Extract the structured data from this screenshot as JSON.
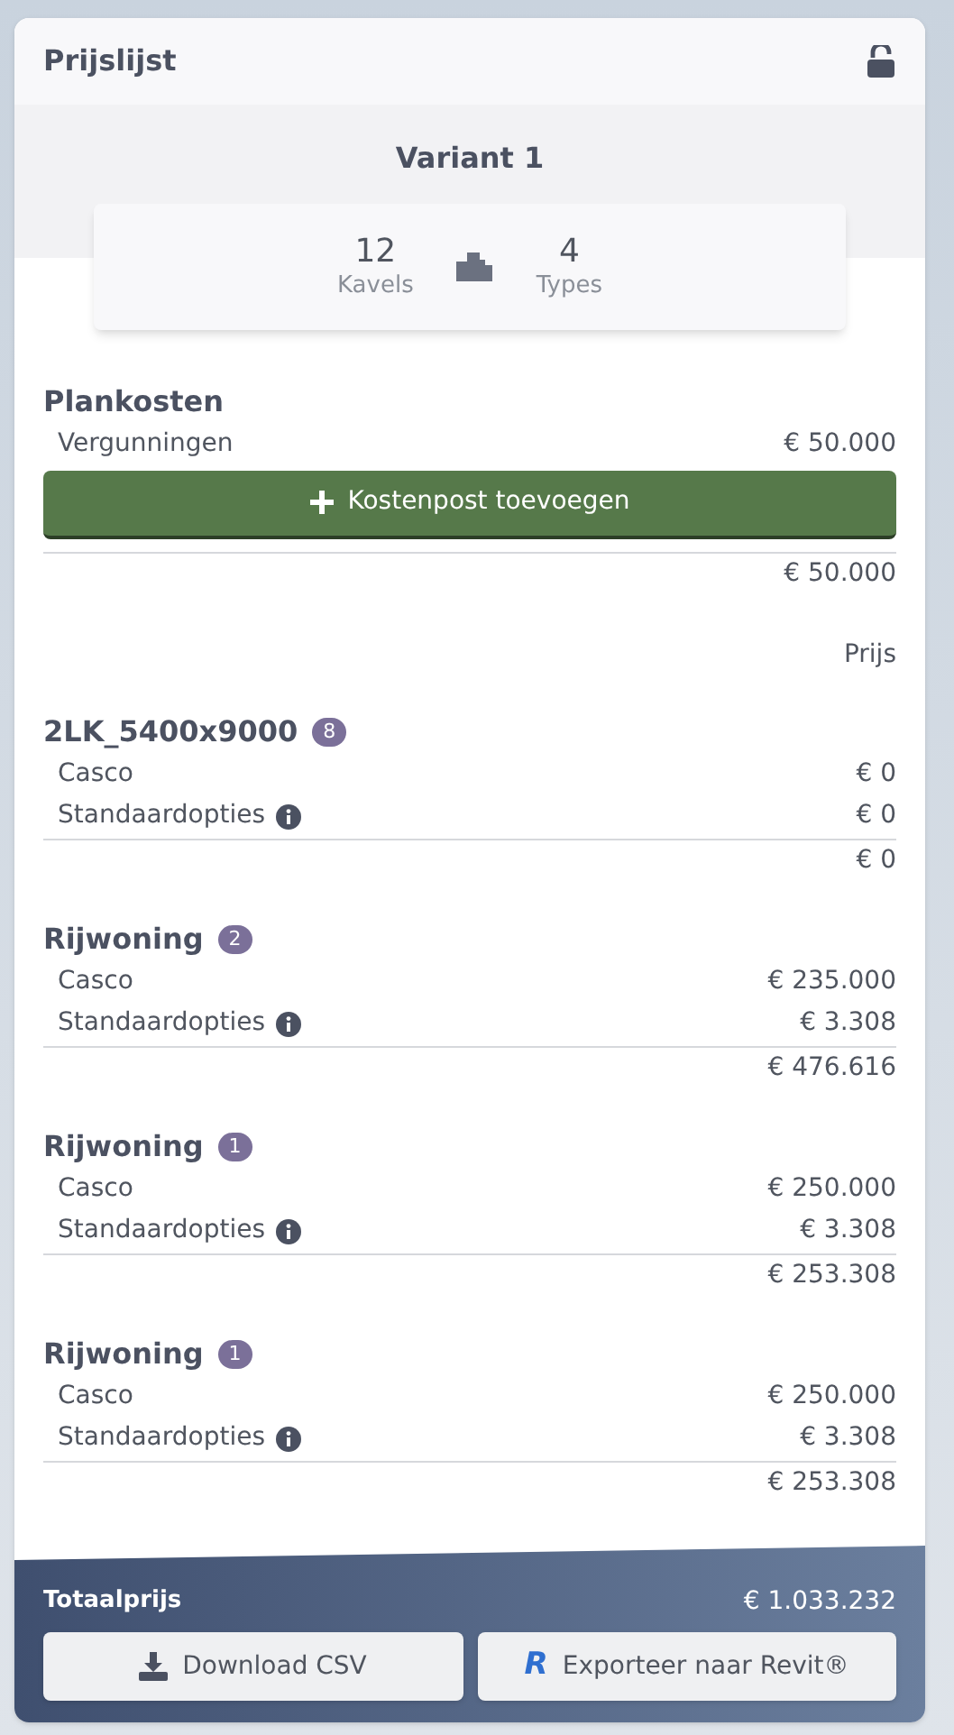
{
  "panel": {
    "title": "Prijslijst",
    "locked": false
  },
  "variant": {
    "title": "Variant 1",
    "stats": [
      {
        "value": "12",
        "label": "Kavels"
      },
      {
        "value": "4",
        "label": "Types"
      }
    ]
  },
  "plankosten": {
    "title": "Plankosten",
    "items": [
      {
        "label": "Vergunningen",
        "price": "€ 50.000"
      }
    ],
    "add_button": "Kostenpost toevoegen",
    "total": "€ 50.000"
  },
  "price_header": "Prijs",
  "groups": [
    {
      "title": "2LK_5400x9000",
      "count": "8",
      "items": [
        {
          "label": "Casco",
          "price": "€ 0",
          "info": false
        },
        {
          "label": "Standaardopties",
          "price": "€ 0",
          "info": true
        }
      ],
      "total": "€ 0"
    },
    {
      "title": "Rijwoning",
      "count": "2",
      "items": [
        {
          "label": "Casco",
          "price": "€ 235.000",
          "info": false
        },
        {
          "label": "Standaardopties",
          "price": "€ 3.308",
          "info": true
        }
      ],
      "total": "€ 476.616"
    },
    {
      "title": "Rijwoning",
      "count": "1",
      "items": [
        {
          "label": "Casco",
          "price": "€ 250.000",
          "info": false
        },
        {
          "label": "Standaardopties",
          "price": "€ 3.308",
          "info": true
        }
      ],
      "total": "€ 253.308"
    },
    {
      "title": "Rijwoning",
      "count": "1",
      "items": [
        {
          "label": "Casco",
          "price": "€ 250.000",
          "info": false
        },
        {
          "label": "Standaardopties",
          "price": "€ 3.308",
          "info": true
        }
      ],
      "total": "€ 253.308"
    }
  ],
  "footer": {
    "total_label": "Totaalprijs",
    "total": "€ 1.033.232",
    "buttons": [
      {
        "kind": "download",
        "label": "Download CSV"
      },
      {
        "kind": "revit",
        "logo": "R",
        "label": "Exporteer naar Revit®"
      }
    ]
  }
}
